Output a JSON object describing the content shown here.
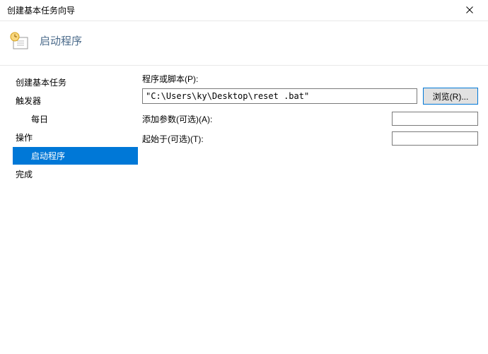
{
  "window": {
    "title": "创建基本任务向导"
  },
  "header": {
    "title": "启动程序"
  },
  "sidebar": {
    "create_task": "创建基本任务",
    "trigger": "触发器",
    "trigger_sub": "每日",
    "action": "操作",
    "action_sub": "启动程序",
    "finish": "完成"
  },
  "form": {
    "program_label": "程序或脚本(P):",
    "program_value": "\"C:\\Users\\ky\\Desktop\\reset .bat\"",
    "browse_label": "浏览(R)...",
    "args_label": "添加参数(可选)(A):",
    "args_value": "",
    "startin_label": "起始于(可选)(T):",
    "startin_value": ""
  }
}
